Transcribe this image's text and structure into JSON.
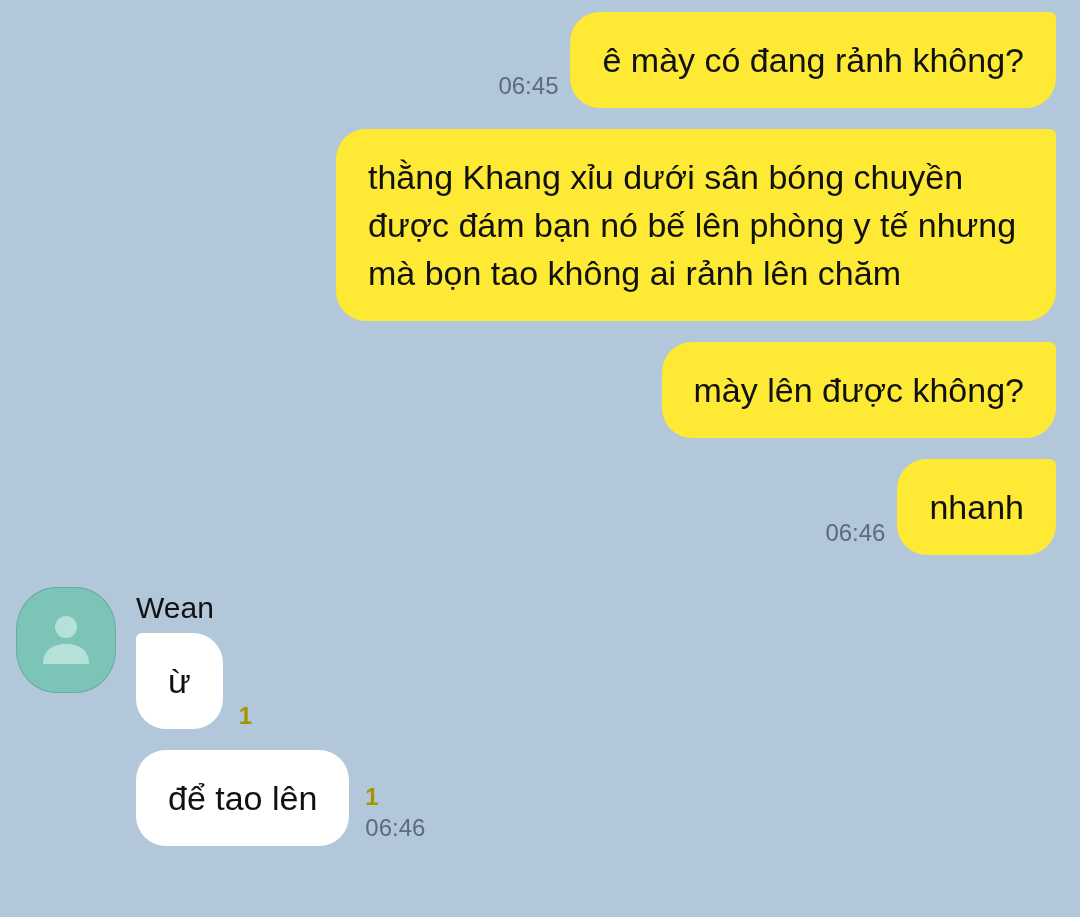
{
  "sent_messages": [
    {
      "text": "ê mày có đang rảnh không?",
      "time": "06:45"
    },
    {
      "text": "thằng Khang xỉu dưới sân bóng chuyền được đám bạn nó bế lên phòng y tế nhưng mà bọn tao không ai rảnh lên chăm"
    },
    {
      "text": "mày lên được không?"
    },
    {
      "text": "nhanh",
      "time": "06:46"
    }
  ],
  "received_group": {
    "sender": "Wean",
    "messages": [
      {
        "text": "ừ",
        "unread": "1"
      },
      {
        "text": "để tao lên",
        "unread": "1",
        "time": "06:46"
      }
    ]
  }
}
